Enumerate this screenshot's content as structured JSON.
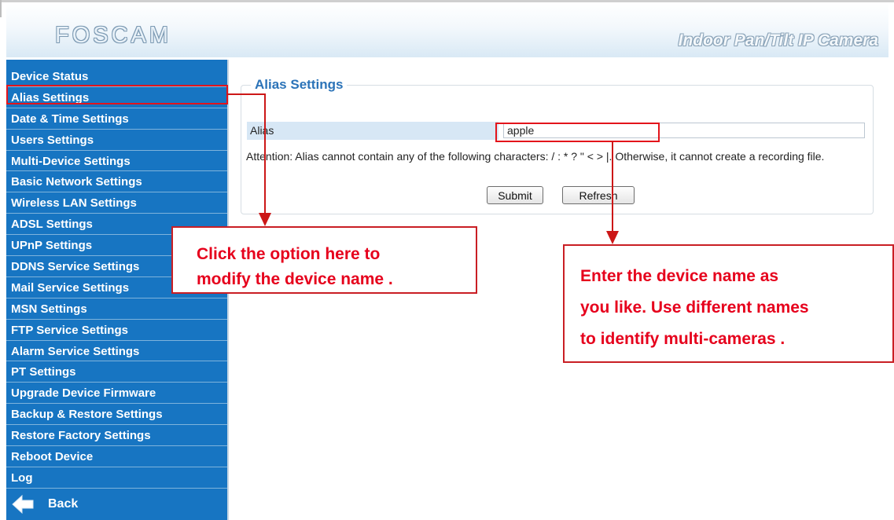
{
  "header": {
    "logo": "FOSCAM",
    "tagline": "Indoor Pan/Tilt IP Camera"
  },
  "sidebar": {
    "items": [
      {
        "label": "Device Status"
      },
      {
        "label": "Alias Settings"
      },
      {
        "label": "Date & Time Settings"
      },
      {
        "label": "Users Settings"
      },
      {
        "label": "Multi-Device Settings"
      },
      {
        "label": "Basic Network Settings"
      },
      {
        "label": "Wireless LAN Settings"
      },
      {
        "label": "ADSL Settings"
      },
      {
        "label": "UPnP Settings"
      },
      {
        "label": "DDNS Service Settings"
      },
      {
        "label": "Mail Service Settings"
      },
      {
        "label": "MSN Settings"
      },
      {
        "label": "FTP Service Settings"
      },
      {
        "label": "Alarm Service Settings"
      },
      {
        "label": "PT Settings"
      },
      {
        "label": "Upgrade Device Firmware"
      },
      {
        "label": "Backup & Restore Settings"
      },
      {
        "label": "Restore Factory Settings"
      },
      {
        "label": "Reboot Device"
      },
      {
        "label": "Log"
      }
    ],
    "back_label": "Back",
    "back_icon": "back-arrow-icon"
  },
  "main": {
    "section_title": "Alias Settings",
    "alias_label": "Alias",
    "alias_value": "apple",
    "attention_text": "Attention: Alias cannot contain any of the following characters: / : * ? \" < > |. Otherwise, it cannot create a recording file.",
    "submit_label": "Submit",
    "refresh_label": "Refresh"
  },
  "annotations": {
    "callout_left_line1": "Click the option here to",
    "callout_left_line2": "modify the device name .",
    "callout_right_line1": "Enter the device name as",
    "callout_right_line2": "you like. Use different names",
    "callout_right_line3": "to identify multi-cameras ."
  },
  "colors": {
    "sidebar_bg": "#1775c2",
    "accent_title": "#2b73b8",
    "annotation_red": "#e6001c"
  }
}
